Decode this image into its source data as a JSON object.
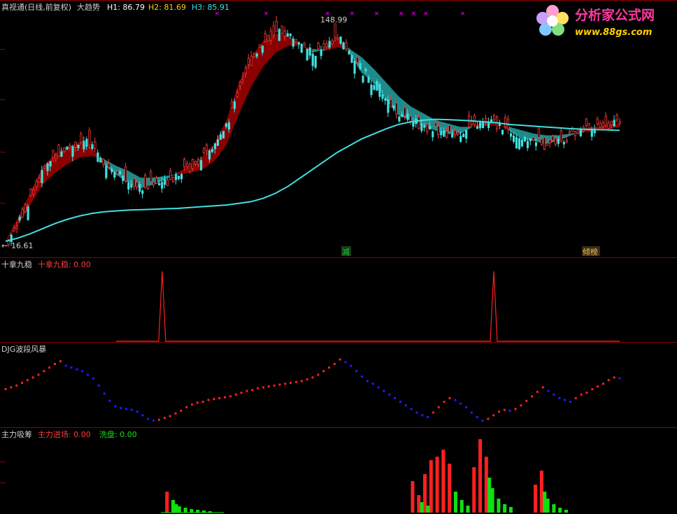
{
  "panels": {
    "main": {
      "title": "真视通(日线,前复权)",
      "indicator": "大趋势",
      "h1_label": "H1: 86.79",
      "h2_label": "H2: 81.69",
      "h3_label": "H3: 85.91",
      "high_label": "148.99",
      "low_label": "16.61",
      "markers": [
        {
          "text": "减",
          "color": "#19c832"
        },
        {
          "text": "倾榜",
          "color": "#e8c060"
        }
      ]
    },
    "p2": {
      "title": "十拿九稳",
      "value_label": "十拿九稳: 0.00"
    },
    "p3": {
      "title": "DJG波段风暴"
    },
    "p4": {
      "title": "主力吸筹",
      "label1": "主力进场: 0.00",
      "label2": "洗盘: 0.00"
    }
  },
  "watermark": {
    "name": "分析家公式网",
    "url": "www.88gs.com"
  },
  "colors": {
    "grid": "#8b0000",
    "up": "#ff3a3a",
    "down": "#40e0e0",
    "ma": "#40e0e0",
    "band_up": "#8b0000",
    "band_down": "#1e8a8a",
    "magenta": "#ff00ff",
    "blue": "#1e1eff",
    "red": "#ff2020",
    "green": "#10e010"
  },
  "chart_data": [
    {
      "type": "line",
      "title": "大趋势",
      "y_high": 148.99,
      "y_low": 16.61,
      "ylim": [
        16.61,
        148.99
      ],
      "trend_line": [
        16.61,
        18.5,
        21,
        24,
        27,
        29.5,
        31.5,
        33,
        34,
        34.5,
        35,
        35.2,
        35.5,
        35.8,
        36,
        36.5,
        37,
        37.5,
        38,
        39,
        40,
        42,
        45,
        49,
        54,
        59,
        64,
        69,
        73,
        77,
        80,
        83,
        85.5,
        87,
        88,
        88.5,
        88.3,
        88,
        87.6,
        87,
        86.5,
        85.5,
        85,
        84.5,
        84,
        83.5,
        83,
        82.7,
        82.5,
        82.3,
        82
      ],
      "band_fast": [
        16.61,
        30,
        45,
        60,
        68,
        72,
        75,
        72,
        62,
        56,
        51,
        48,
        50,
        53,
        57,
        61,
        66,
        74,
        88,
        110,
        125,
        135,
        139,
        138,
        132,
        128,
        130,
        137,
        128,
        116,
        110,
        100,
        91,
        88,
        85,
        82,
        80,
        80,
        84,
        87,
        86,
        82,
        77,
        76,
        74,
        76,
        79,
        82,
        84,
        85,
        85.91
      ],
      "band_slow": [
        16.61,
        26,
        38,
        50,
        57,
        62,
        66,
        67,
        65,
        61,
        58,
        54,
        54,
        55,
        56,
        57,
        59,
        64,
        74,
        92,
        108,
        120,
        128,
        132,
        132,
        130,
        129,
        131,
        130,
        125,
        118,
        110,
        102,
        96,
        92,
        88,
        86,
        84,
        84,
        85,
        85,
        84,
        82,
        80,
        79,
        79,
        80,
        81,
        82,
        83,
        84
      ],
      "sell_markers_x": [
        0.34,
        0.42,
        0.52,
        0.56,
        0.6,
        0.64,
        0.66,
        0.68,
        0.74
      ],
      "candles_n": 220
    },
    {
      "type": "line",
      "title": "十拿九稳",
      "spikes_x": [
        0.255,
        0.795
      ],
      "value": 0.0
    },
    {
      "type": "scatter",
      "title": "DJG波段风暴",
      "values": [
        60,
        62,
        64,
        67,
        70,
        73,
        76,
        80,
        84,
        88,
        91,
        86,
        84,
        82,
        80,
        76,
        72,
        64,
        55,
        47,
        41,
        39,
        38,
        37,
        35,
        31,
        27,
        25,
        26,
        28,
        30,
        33,
        36,
        40,
        43,
        45,
        46,
        48,
        49,
        50,
        51,
        52,
        54,
        56,
        58,
        59,
        61,
        62,
        63,
        64,
        65,
        66,
        67,
        68,
        69,
        71,
        73,
        76,
        80,
        84,
        88,
        93,
        90,
        86,
        80,
        74,
        69,
        66,
        62,
        58,
        54,
        50,
        46,
        42,
        38,
        34,
        31,
        29,
        34,
        40,
        46,
        50,
        48,
        44,
        40,
        34,
        29,
        25,
        27,
        31,
        35,
        37,
        36,
        38,
        42,
        47,
        52,
        57,
        62,
        58,
        54,
        50,
        48,
        46,
        50,
        54,
        56,
        60,
        63,
        66,
        70,
        73,
        72
      ],
      "trend": [
        "up",
        "up",
        "up",
        "up",
        "up",
        "up",
        "up",
        "up",
        "up",
        "up",
        "up",
        "down",
        "down",
        "down",
        "down",
        "down",
        "down",
        "down",
        "down",
        "down",
        "down",
        "down",
        "down",
        "down",
        "down",
        "down",
        "down",
        "down",
        "up",
        "up",
        "up",
        "up",
        "up",
        "up",
        "up",
        "up",
        "up",
        "up",
        "up",
        "up",
        "up",
        "up",
        "up",
        "up",
        "up",
        "up",
        "up",
        "up",
        "up",
        "up",
        "up",
        "up",
        "up",
        "up",
        "up",
        "up",
        "up",
        "up",
        "up",
        "up",
        "up",
        "up",
        "down",
        "down",
        "down",
        "down",
        "down",
        "down",
        "down",
        "down",
        "down",
        "down",
        "down",
        "down",
        "down",
        "down",
        "down",
        "down",
        "up",
        "up",
        "up",
        "up",
        "down",
        "down",
        "down",
        "down",
        "down",
        "down",
        "up",
        "up",
        "up",
        "up",
        "down",
        "up",
        "up",
        "up",
        "up",
        "up",
        "up",
        "down",
        "down",
        "down",
        "down",
        "down",
        "up",
        "up",
        "up",
        "up",
        "up",
        "up",
        "up",
        "up",
        "down"
      ]
    },
    {
      "type": "bar",
      "title": "主力吸筹",
      "series": [
        {
          "name": "主力进场",
          "at": [
            0.26,
            0.66,
            0.67,
            0.68,
            0.69,
            0.7,
            0.71,
            0.72,
            0.76,
            0.77,
            0.78,
            0.86,
            0.87
          ],
          "values": [
            30,
            45,
            25,
            55,
            75,
            80,
            90,
            70,
            65,
            105,
            80,
            40,
            60
          ]
        },
        {
          "name": "洗盘",
          "at": [
            0.27,
            0.275,
            0.28,
            0.29,
            0.3,
            0.31,
            0.32,
            0.33,
            0.675,
            0.685,
            0.73,
            0.74,
            0.75,
            0.785,
            0.79,
            0.8,
            0.81,
            0.82,
            0.875,
            0.88,
            0.89,
            0.9,
            0.91
          ],
          "values": [
            18,
            12,
            9,
            7,
            5,
            4,
            3,
            2,
            15,
            10,
            30,
            18,
            10,
            50,
            35,
            20,
            12,
            8,
            30,
            20,
            12,
            7,
            4
          ]
        }
      ],
      "values": [
        0.0,
        0.0
      ]
    }
  ]
}
